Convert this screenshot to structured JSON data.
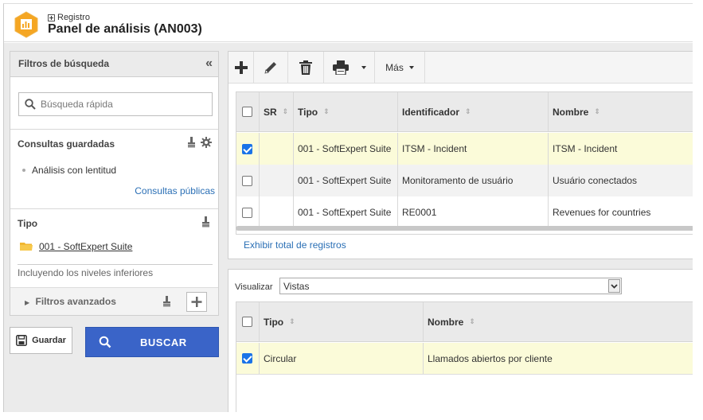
{
  "header": {
    "breadcrumb": "Registro",
    "title": "Panel de análisis (AN003)"
  },
  "filters": {
    "title": "Filtros de búsqueda",
    "search_placeholder": "Búsqueda rápida",
    "saved_queries_title": "Consultas guardadas",
    "saved_queries": [
      "Análisis con lentitud"
    ],
    "public_queries_link": "Consultas públicas",
    "type_title": "Tipo",
    "type_value": "001 - SoftExpert Suite",
    "including_text": "Incluyendo los niveles inferiores",
    "advanced_label": "Filtros avanzados"
  },
  "buttons": {
    "save": "Guardar",
    "search": "BUSCAR"
  },
  "toolbar": {
    "more_label": "Más"
  },
  "grid1": {
    "columns": [
      "SR",
      "Tipo",
      "Identificador",
      "Nombre"
    ],
    "rows": [
      {
        "checked": true,
        "sr": "",
        "tipo": "001 - SoftExpert Suite",
        "identificador": "ITSM - Incident",
        "nombre": "ITSM - Incident"
      },
      {
        "checked": false,
        "sr": "",
        "tipo": "001 - SoftExpert Suite",
        "identificador": "Monitoramento de usuário",
        "nombre": "Usuário conectados"
      },
      {
        "checked": false,
        "sr": "",
        "tipo": "001 - SoftExpert Suite",
        "identificador": "RE0001",
        "nombre": "Revenues for countries"
      }
    ],
    "show_total_link": "Exhibir total de registros"
  },
  "visualize": {
    "label": "Visualizar",
    "selected": "Vistas"
  },
  "grid2": {
    "columns": [
      "Tipo",
      "Nombre"
    ],
    "rows": [
      {
        "checked": true,
        "tipo": "Circular",
        "nombre": "Llamados abiertos por cliente"
      }
    ]
  },
  "colors": {
    "selected_row": "#fbfbd9",
    "accent_blue": "#3a64c8",
    "logo_orange": "#f5a623",
    "link": "#2a6fb5"
  }
}
